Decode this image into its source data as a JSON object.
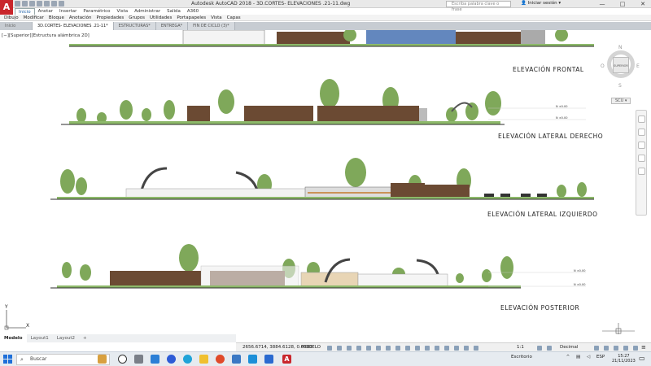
{
  "titlebar": {
    "app_icon_letter": "A",
    "title": "Autodesk AutoCAD 2018    - 3D.CORTES- ELEVACIONES .21-11.dwg",
    "search_placeholder": "Escriba palabra clave o frase",
    "signin": "Iniciar sesión",
    "window_buttons": [
      "—",
      "□",
      "✕"
    ]
  },
  "ribbon_tabs": [
    "Inicio",
    "Anotar",
    "Insertar",
    "Paramétrico",
    "Vista",
    "Administrar",
    "Salida",
    "A360"
  ],
  "menubar": [
    "Dibujo",
    "Modificar",
    "Bloque",
    "Anotación",
    "Propiedades",
    "Grupos",
    "Utilidades",
    "Portapapeles",
    "Vista",
    "Capas"
  ],
  "doc_tabs": [
    {
      "label": "Inicio",
      "active": false
    },
    {
      "label": "3D.CORTES- ELEVACIONES .21-11*",
      "active": true
    },
    {
      "label": "ESTRUCTURAS*",
      "active": false
    },
    {
      "label": "ENTREGA*",
      "active": false
    },
    {
      "label": "FIN DE CICLO (3)*",
      "active": false
    }
  ],
  "viewport": {
    "label": "[−][Superior][Estructura alámbrica 2D]",
    "titles": {
      "frontal": "ELEVACIÓN FRONTAL",
      "lateral_derecho": "ELEVACIÓN LATERAL DERECHO",
      "lateral_izquierdo": "ELEVACIÓN LATERAL IZQUIERDO",
      "posterior": "ELEVACIÓN POSTERIOR"
    },
    "level_tag": "N ±0.00"
  },
  "navcube": {
    "n": "N",
    "s": "S",
    "e": "E",
    "w": "O",
    "face": "SUPERIOR",
    "scu": "SCU ▾"
  },
  "ucs": {
    "x": "X",
    "y": "Y"
  },
  "layout_tabs": [
    {
      "label": "Modelo",
      "active": true
    },
    {
      "label": "Layout1",
      "active": false
    },
    {
      "label": "Layout2",
      "active": false
    },
    {
      "label": "+",
      "active": false
    }
  ],
  "statusbar": {
    "coords": "2656.6714, 3884.6128, 0.0000",
    "model": "MODELO",
    "scale": "1:1",
    "units": "Decimal"
  },
  "taskbar": {
    "search": "Buscar",
    "tray_label": "Escritorio",
    "lang": "ESP",
    "time": "15:27",
    "date": "21/11/2023"
  },
  "colors": {
    "tree": "#7fa85a",
    "tree_dark": "#5c8a3c",
    "wood": "#6b4a33",
    "ground": "#2b2b2b",
    "grass": "#8db96a",
    "accent": "#c9262c"
  }
}
